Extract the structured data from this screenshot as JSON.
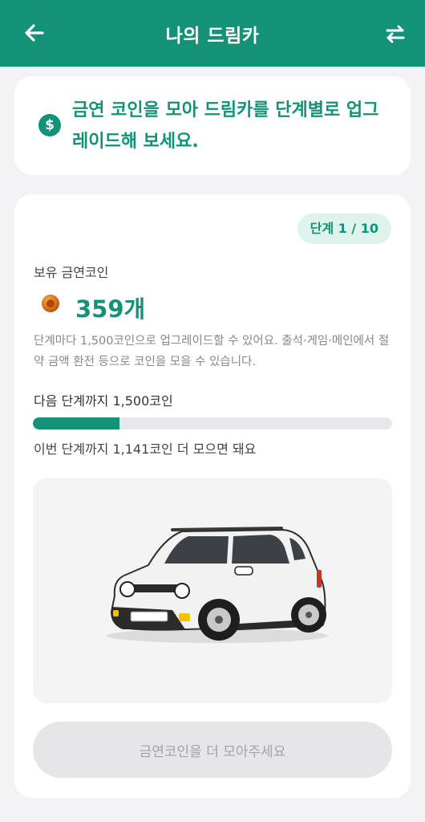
{
  "header": {
    "title": "나의 드림카",
    "back_icon": "back-arrow-icon",
    "swap_icon": "swap-arrows-icon"
  },
  "intro": {
    "coin_symbol": "$",
    "message": "금연 코인을 모아 드림카를 단계별로 업그레이드해 보세요."
  },
  "progress": {
    "stage_badge": "단계 1 / 10",
    "coins_label": "보유 금연코인",
    "coins_amount": "359개",
    "description": "단계마다 1,500코인으로 업그레이드할 수 있어요. 출석·게임·메인에서 절약 금액 환전 등으로 코인을 모을 수 있습니다.",
    "next_stage_text": "다음 단계까지 1,500코인",
    "fill_fraction": 0.24,
    "remaining_text": "이번 단계까지 1,141코인 더 모으면 돼요"
  },
  "cta": {
    "label": "금연코인을 더 모아주세요"
  },
  "colors": {
    "brand": "#139277",
    "badge_bg": "#ddf3ec",
    "disabled_bg": "#e6e6e9"
  }
}
